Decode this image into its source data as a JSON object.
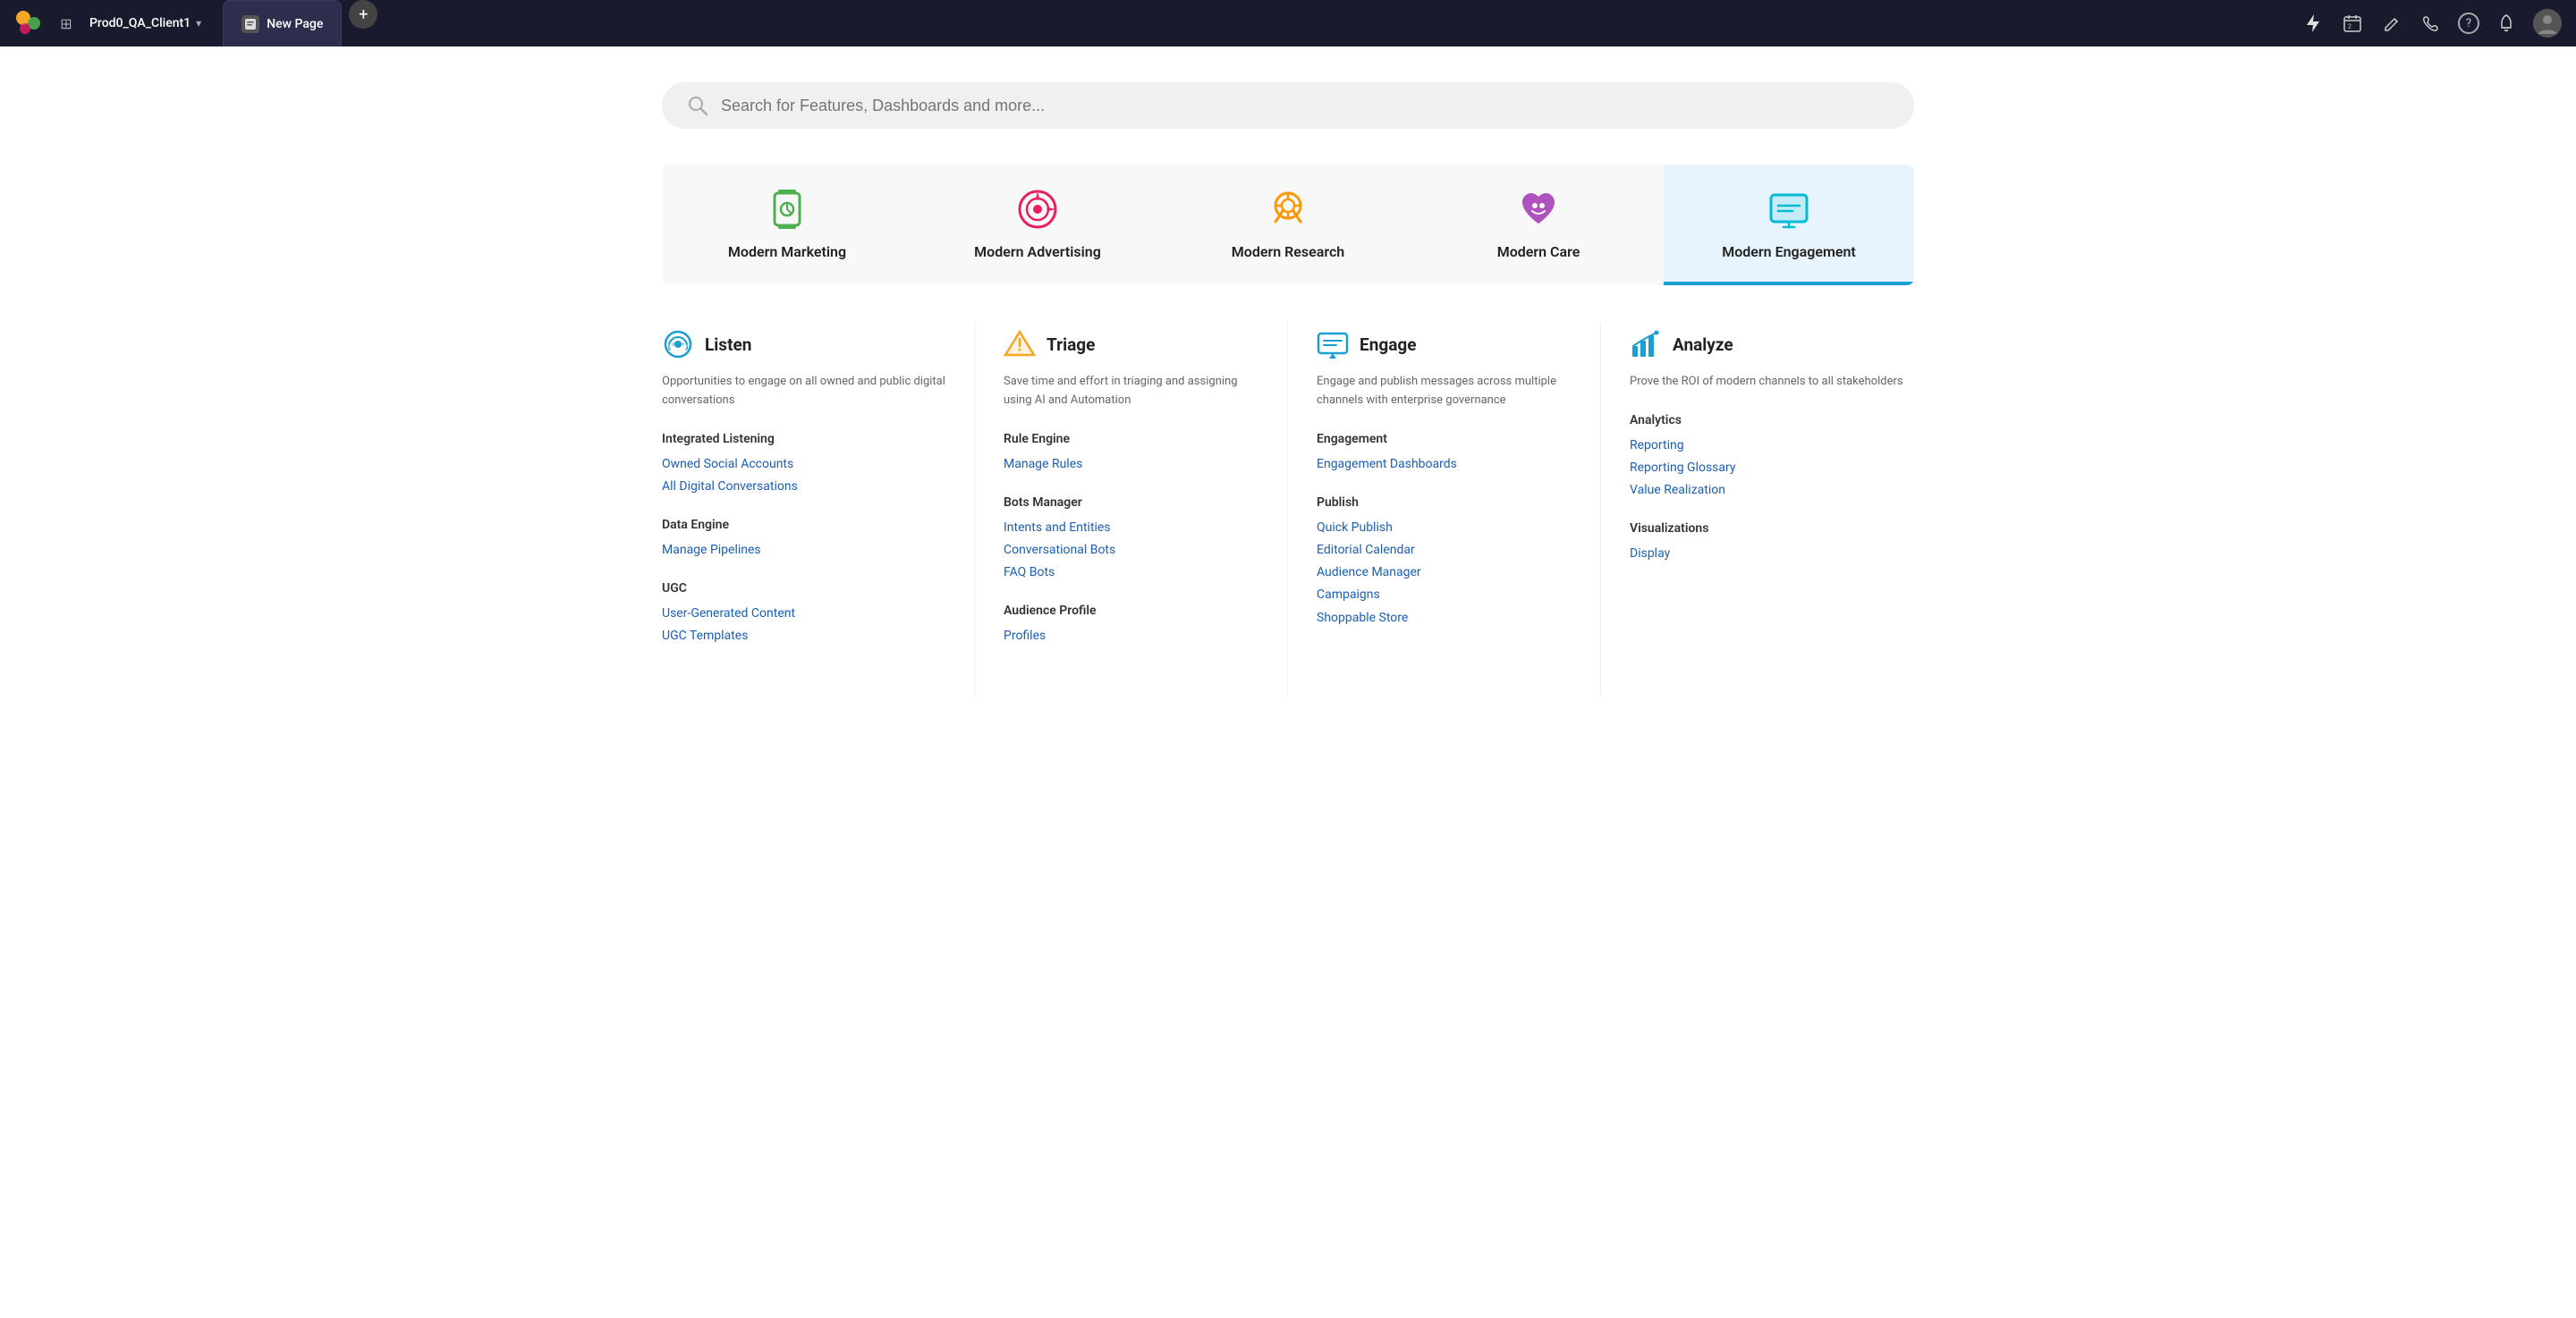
{
  "topnav": {
    "workspace": "Prod0_QA_Client1",
    "tab_title": "New Page",
    "add_tab_label": "+",
    "icons": {
      "grid": "⊞",
      "lightning": "⚡",
      "calendar": "📅",
      "edit": "✏️",
      "phone": "📞",
      "help": "?",
      "bell": "🔔",
      "avatar": "👤"
    }
  },
  "search": {
    "placeholder": "Search for Features, Dashboards and more..."
  },
  "categories": [
    {
      "id": "modern-marketing",
      "label": "Modern Marketing",
      "icon_color": "#4caf50",
      "active": false
    },
    {
      "id": "modern-advertising",
      "label": "Modern Advertising",
      "icon_color": "#e91e63",
      "active": false
    },
    {
      "id": "modern-research",
      "label": "Modern Research",
      "icon_color": "#ff9800",
      "active": false
    },
    {
      "id": "modern-care",
      "label": "Modern Care",
      "icon_color": "#9c27b0",
      "active": false
    },
    {
      "id": "modern-engagement",
      "label": "Modern Engagement",
      "icon_color": "#00bcd4",
      "active": true
    }
  ],
  "columns": [
    {
      "id": "listen",
      "icon_color": "#1a9fd4",
      "title": "Listen",
      "description": "Opportunities to engage on all owned and public digital conversations",
      "sections": [
        {
          "header": "Integrated Listening",
          "links": [
            "Owned Social Accounts",
            "All Digital Conversations"
          ]
        },
        {
          "header": "Data Engine",
          "links": [
            "Manage Pipelines"
          ]
        },
        {
          "header": "UGC",
          "links": [
            "User-Generated Content",
            "UGC Templates"
          ]
        }
      ]
    },
    {
      "id": "triage",
      "icon_color": "#f5a623",
      "title": "Triage",
      "description": "Save time and effort in triaging and assigning using AI and Automation",
      "sections": [
        {
          "header": "Rule Engine",
          "links": [
            "Manage Rules"
          ]
        },
        {
          "header": "Bots Manager",
          "links": [
            "Intents and Entities",
            "Conversational Bots",
            "FAQ Bots"
          ]
        },
        {
          "header": "Audience Profile",
          "links": [
            "Profiles"
          ]
        }
      ]
    },
    {
      "id": "engage",
      "icon_color": "#1a9fd4",
      "title": "Engage",
      "description": "Engage and publish messages across multiple channels with enterprise governance",
      "sections": [
        {
          "header": "Engagement",
          "links": [
            "Engagement Dashboards"
          ]
        },
        {
          "header": "Publish",
          "links": [
            "Quick Publish",
            "Editorial Calendar",
            "Audience Manager",
            "Campaigns",
            "Shoppable Store"
          ]
        }
      ]
    },
    {
      "id": "analyze",
      "icon_color": "#1a9fd4",
      "title": "Analyze",
      "description": "Prove the ROI of modern channels to all stakeholders",
      "sections": [
        {
          "header": "Analytics",
          "links": [
            "Reporting",
            "Reporting Glossary",
            "Value Realization"
          ]
        },
        {
          "header": "Visualizations",
          "links": [
            "Display"
          ]
        }
      ]
    }
  ]
}
